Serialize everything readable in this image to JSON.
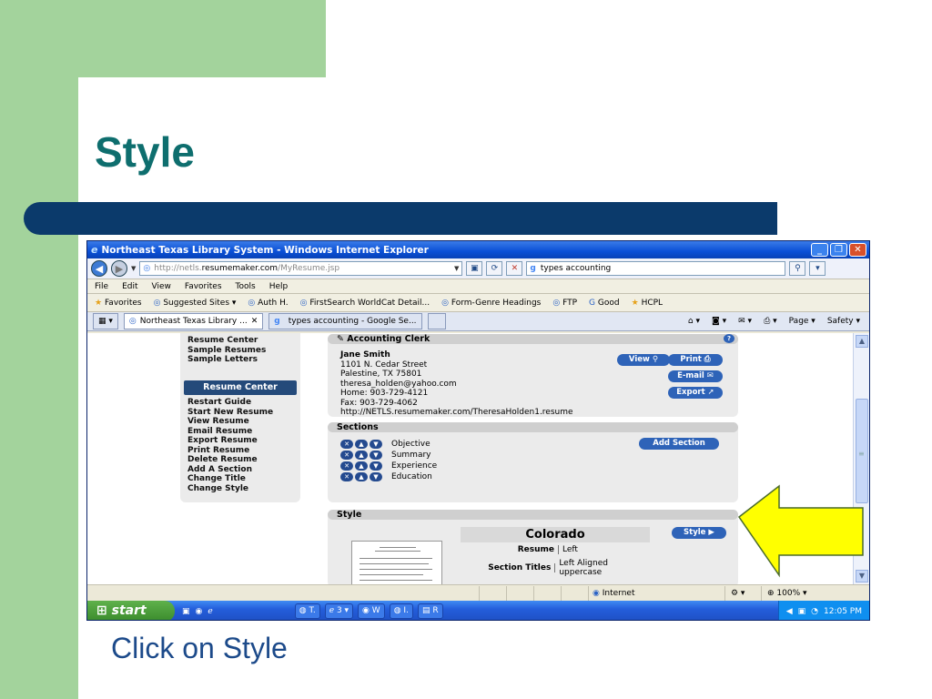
{
  "slide": {
    "title": "Style",
    "caption": "Click on Style"
  },
  "window": {
    "title": "Northeast Texas Library System - Windows Internet Explorer"
  },
  "address": {
    "url_prefix": "http://netls.",
    "url_domain": "resumemaker.com",
    "url_path": "/MyResume.jsp",
    "search_value": "types accounting"
  },
  "menu": [
    "File",
    "Edit",
    "View",
    "Favorites",
    "Tools",
    "Help"
  ],
  "favorites": {
    "label": "Favorites",
    "items": [
      "Suggested Sites ▾",
      "Auth H.",
      "FirstSearch WorldCat Detail...",
      "Form-Genre Headings",
      "FTP",
      "Good",
      "HCPL"
    ]
  },
  "tabs": [
    "Northeast Texas Library ...",
    "types accounting - Google Se..."
  ],
  "toolbar_right": [
    "Page ▾",
    "Safety ▾"
  ],
  "left_panel": {
    "top_links": [
      "Resume Center",
      "Sample Resumes",
      "Sample Letters"
    ],
    "header": "Resume Center",
    "links": [
      "Restart Guide",
      "Start New Resume",
      "View Resume",
      "Email Resume",
      "Export Resume",
      "Print Resume",
      "Delete Resume",
      "Add A Section",
      "Change Title",
      "Change Style"
    ]
  },
  "resume_panel": {
    "title": "Accounting Clerk",
    "name": "Jane Smith",
    "lines": [
      "1101 N. Cedar Street",
      "Palestine, TX 75801",
      "theresa_holden@yahoo.com",
      "Home: 903-729-4121",
      "Fax: 903-729-4062",
      "http://NETLS.resumemaker.com/TheresaHolden1.resume"
    ],
    "buttons": {
      "view": "View",
      "print": "Print",
      "email": "E-mail",
      "export": "Export"
    }
  },
  "sections_panel": {
    "title": "Sections",
    "items": [
      "Objective",
      "Summary",
      "Experience",
      "Education"
    ],
    "add_button": "Add Section"
  },
  "style_panel": {
    "title": "Style",
    "style_name": "Colorado",
    "style_button": "Style ▶",
    "rows": [
      {
        "key": "Resume",
        "value": "Left"
      },
      {
        "key": "Section Titles",
        "value": "Left Aligned uppercase"
      }
    ]
  },
  "status": {
    "zone": "Internet",
    "zoom": "100%"
  },
  "taskbar": {
    "start": "start",
    "items": [
      "T.",
      "3 ▾",
      "W",
      "I.",
      "R"
    ],
    "clock": "12:05 PM"
  },
  "colors": {
    "slide_green": "#a3d39c",
    "slide_blue": "#0b3a6b",
    "title_teal": "#0e6e6e",
    "arrow_yellow": "#ffff00"
  }
}
